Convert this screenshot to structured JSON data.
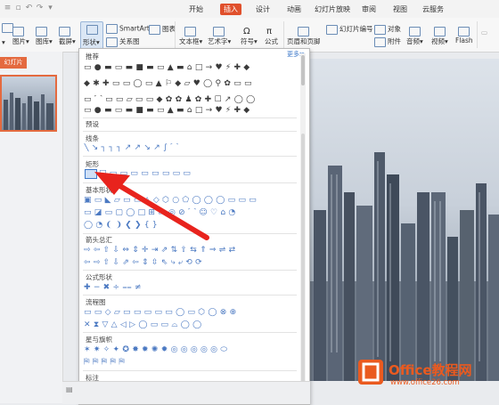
{
  "menu_tabs": [
    "开始",
    "插入",
    "设计",
    "动画",
    "幻灯片放映",
    "审阅",
    "视图",
    "云服务"
  ],
  "active_tab": "插入",
  "ribbon": {
    "smartart": "SmartArt",
    "chart": "图表",
    "picture": "图片",
    "gallery": "图库",
    "screenshot": "截屏",
    "shape": "形状",
    "relation": "关系图",
    "textbox": "文本框",
    "wordart": "艺术字",
    "symbol": "符号",
    "formula": "公式",
    "header_footer": "页眉和页脚",
    "slide_number": "幻灯片编号",
    "object": "对象",
    "attachment": "附件",
    "audio": "音频",
    "video": "视频",
    "flash": "Flash"
  },
  "panel": {
    "tab_label": "幻灯片"
  },
  "shapes_panel": {
    "recommended_title": "推荐",
    "more_link": "更多≫",
    "preset_title": "预设",
    "sections": [
      "线条",
      "矩形",
      "基本形状",
      "箭头总汇",
      "公式形状",
      "流程图",
      "星与旗帜",
      "标注"
    ],
    "recommended_rows": [
      "▭●▬▭▬■▬▭▲▬⌂□→♥⚡✚◆",
      "◆✱✚▭▭◯▭▲⚐◆▱♥◯⚲✿▭▭",
      "▭⌒▭▭▱▭▭◆✿✿♟✿✚☐↗◯◯"
    ],
    "line_row": "╲↘┐┐┐↗↗↘↗∫⌒",
    "rect_row": "□▭▭▭▭▭▭▭▭",
    "basic_rows": [
      "▣▭◣▱▭▭△◇⬡○⬠◯◯◯▭▭▭",
      "▭◪▭▢◯□⊞▭◎⊘⌒☺♡⌂◔",
      "◯◔❨❩❮❯{}"
    ],
    "arrow_rows": [
      "⇨⇦⇧⇩⇔⇕✛⇥⇗⇅⇧⇆⇑⇒⇌⇄",
      "⇦⇨⇧⇩⇗⇦⇕⇳⇖⤷⤶⟲⟳"
    ],
    "formula_row": "✚−✖÷⩵≠",
    "flow_rows": [
      "▭▭◇▱▭▭▭▭▭◯▭⬡◯⊗⊕",
      "✕⧗▽△◁▷◯▭▭⌓◯◯"
    ],
    "star_rows": [
      "✶✷✧✦✪✸✹✺✹◎◎◎◎◎⬭",
      "⛿⛿⛿⛿⛿"
    ],
    "callout_row": "▭▭▭◯◯▭▭▭▭▭▭▭▭▭▭"
  },
  "watermark": {
    "title": "Office教程网",
    "url": "www.office26.com"
  }
}
